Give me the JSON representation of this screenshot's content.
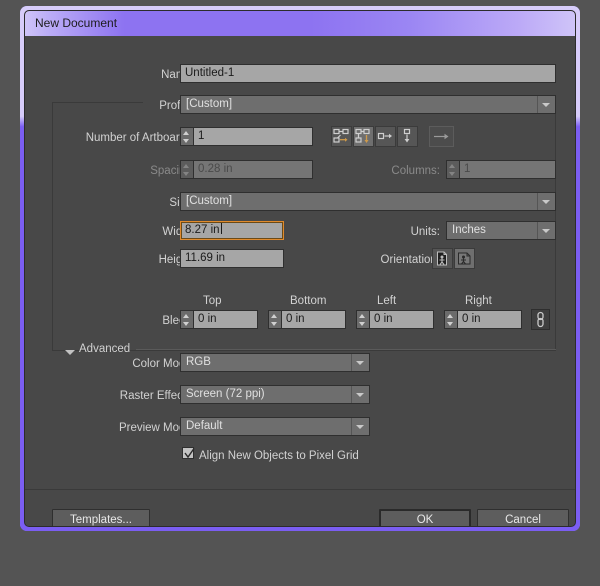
{
  "window": {
    "title": "New Document"
  },
  "fields": {
    "name_label": "Name:",
    "name_value": "Untitled-1",
    "profile_label": "Profile:",
    "profile_value": "[Custom]",
    "artboards_label": "Number of Artboards:",
    "artboards_value": "1",
    "spacing_label": "Spacing:",
    "spacing_value": "0.28 in",
    "columns_label": "Columns:",
    "columns_value": "1",
    "size_label": "Size:",
    "size_value": "[Custom]",
    "width_label": "Width:",
    "width_value": "8.27 in",
    "units_label": "Units:",
    "units_value": "Inches",
    "height_label": "Height:",
    "height_value": "11.69 in",
    "orientation_label": "Orientation:",
    "bleed_label": "Bleed:",
    "bleed_top_label": "Top",
    "bleed_top_value": "0 in",
    "bleed_bottom_label": "Bottom",
    "bleed_bottom_value": "0 in",
    "bleed_left_label": "Left",
    "bleed_left_value": "0 in",
    "bleed_right_label": "Right",
    "bleed_right_value": "0 in"
  },
  "advanced": {
    "header": "Advanced",
    "color_mode_label": "Color Mode:",
    "color_mode_value": "RGB",
    "raster_label": "Raster Effects:",
    "raster_value": "Screen (72 ppi)",
    "preview_label": "Preview Mode:",
    "preview_value": "Default",
    "align_checkbox_label": "Align New Objects to Pixel Grid",
    "align_checked": true
  },
  "buttons": {
    "templates": "Templates...",
    "ok": "OK",
    "cancel": "Cancel"
  },
  "icons": {
    "arrange_grid_rows": "arrange-by-row-icon",
    "arrange_grid_cols": "arrange-by-column-icon",
    "arrange_row": "arrange-in-one-row-icon",
    "arrange_column": "arrange-in-one-column-icon",
    "flow_direction": "change-to-right-to-left-layout-icon",
    "orientation_portrait": "orientation-portrait-icon",
    "orientation_landscape": "orientation-landscape-icon",
    "bleed_link": "link-bleed-values-icon"
  },
  "colors": {
    "dialog_accent": "#7b5ef2",
    "titlebar_light": "#cfc4f8",
    "body_bg": "#484848",
    "input_bg": "#a6a6a6",
    "focus_ring": "#e08a2c"
  }
}
